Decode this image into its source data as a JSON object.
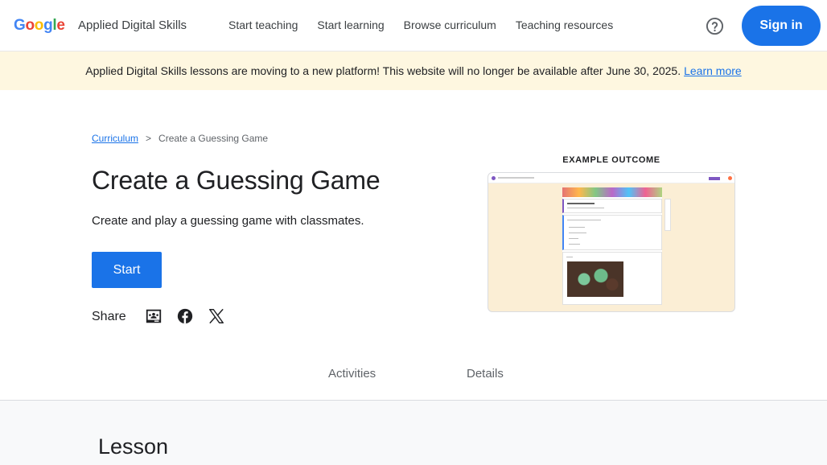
{
  "header": {
    "logo_letters": [
      {
        "ch": "G",
        "color": "#4285F4"
      },
      {
        "ch": "o",
        "color": "#EA4335"
      },
      {
        "ch": "o",
        "color": "#FBBC05"
      },
      {
        "ch": "g",
        "color": "#4285F4"
      },
      {
        "ch": "l",
        "color": "#34A853"
      },
      {
        "ch": "e",
        "color": "#EA4335"
      }
    ],
    "brand": "Applied Digital Skills",
    "nav": [
      "Start teaching",
      "Start learning",
      "Browse curriculum",
      "Teaching resources"
    ],
    "help_icon": "help-circle-icon",
    "sign_in": "Sign in"
  },
  "banner": {
    "message": "Applied Digital Skills lessons are moving to a new platform! This website will no longer be available after June 30, 2025.",
    "link": "Learn more"
  },
  "breadcrumb": {
    "root": "Curriculum",
    "separator": ">",
    "current": "Create a Guessing Game"
  },
  "lesson": {
    "title": "Create a Guessing Game",
    "description": "Create and play a guessing game with classmates.",
    "start_label": "Start",
    "share_label": "Share",
    "share_icons": [
      "google-classroom-icon",
      "facebook-icon",
      "x-twitter-icon"
    ]
  },
  "example": {
    "label": "EXAMPLE OUTCOME"
  },
  "tabs": [
    "Activities",
    "Details"
  ],
  "section": {
    "title": "Lesson"
  },
  "colors": {
    "accent": "#1a73e8",
    "banner_bg": "#fef7e0",
    "section_bg": "#f8f9fa"
  }
}
